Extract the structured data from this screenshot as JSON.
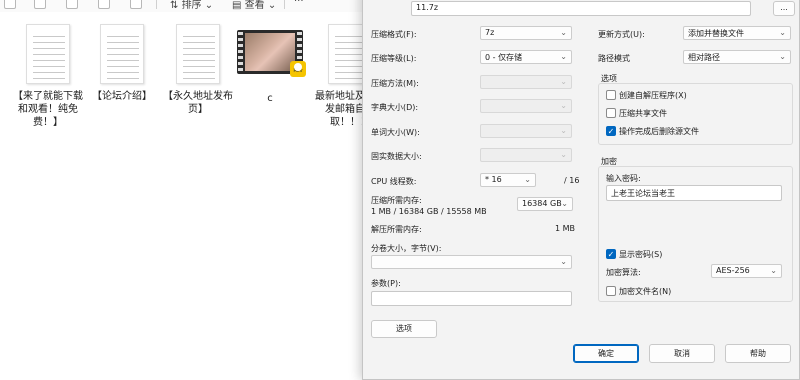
{
  "explorer": {
    "toolbar": {
      "sort_label": "排序",
      "view_label": "查看",
      "more_label": "···"
    },
    "files": [
      {
        "name": "【来了就能下载和观看！纯免费！】",
        "type": "document"
      },
      {
        "name": "【论坛介绍】",
        "type": "document"
      },
      {
        "name": "【永久地址发布页】",
        "type": "document"
      },
      {
        "name": "c",
        "type": "video",
        "badge": "Rev"
      },
      {
        "name": "最新地址及发请发邮箱自动取！！！",
        "type": "document"
      }
    ]
  },
  "dialog": {
    "archive_path": "11.7z",
    "browse_label": "...",
    "left": {
      "format": {
        "label": "压缩格式(F):",
        "value": "7z"
      },
      "level": {
        "label": "压缩等级(L):",
        "value": "0 - 仅存储"
      },
      "method": {
        "label": "压缩方法(M):"
      },
      "dict_size": {
        "label": "字典大小(D):"
      },
      "word_size": {
        "label": "单词大小(W):"
      },
      "solid_block": {
        "label": "固实数据大小:"
      },
      "cpu_threads": {
        "label": "CPU 线程数:",
        "value": "16",
        "max": "/ 16"
      },
      "mem_compress": {
        "label": "压缩所需内存:",
        "detail": "1 MB / 16384 GB / 15558 MB",
        "value": "16384 GB"
      },
      "mem_decompress": {
        "label": "解压所需内存:",
        "value": "1 MB"
      },
      "split": {
        "label": "分卷大小，字节(V):",
        "value": ""
      },
      "params": {
        "label": "参数(P):",
        "value": ""
      },
      "options_button": "选项"
    },
    "right": {
      "update_mode": {
        "label": "更新方式(U):",
        "value": "添加并替换文件"
      },
      "path_mode": {
        "label": "路径模式",
        "value": "相对路径"
      },
      "options_group": {
        "title": "选项",
        "items": [
          {
            "label": "创建自解压程序(X)",
            "checked": false
          },
          {
            "label": "压缩共享文件",
            "checked": false
          },
          {
            "label": "操作完成后删除源文件",
            "checked": true
          }
        ]
      },
      "encryption_group": {
        "title": "加密",
        "password_label": "输入密码:",
        "password_value": "上老王论坛当老王",
        "show_password": {
          "label": "显示密码(S)",
          "checked": true
        },
        "method_label": "加密算法:",
        "method_value": "AES-256",
        "encrypt_names": {
          "label": "加密文件名(N)",
          "checked": false
        }
      }
    },
    "buttons": {
      "ok": "确定",
      "cancel": "取消",
      "help": "帮助"
    }
  }
}
